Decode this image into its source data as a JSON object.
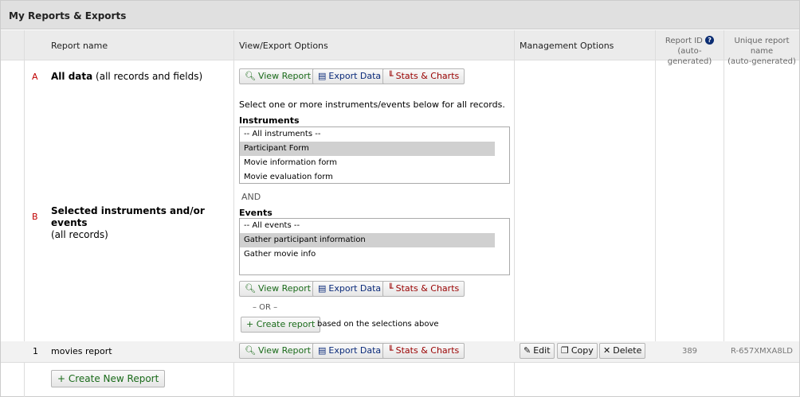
{
  "panel": {
    "title": "My Reports & Exports"
  },
  "columns": {
    "report_name": "Report name",
    "view_export": "View/Export Options",
    "management": "Management Options",
    "report_id": "Report ID",
    "report_id_sub": "(auto-generated)",
    "unique_name": "Unique report name",
    "unique_name_sub": "(auto-generated)",
    "help_glyph": "?"
  },
  "buttons": {
    "view_report": "View Report",
    "export_data": "Export Data",
    "stats_charts": "Stats & Charts",
    "create_report": "+ Create report",
    "create_new_report": "+ Create New Report",
    "edit": "Edit",
    "copy": "Copy",
    "delete": "Delete"
  },
  "icons": {
    "view": "search-icon",
    "export": "file-icon",
    "stats": "chart-icon",
    "edit": "pencil-icon",
    "copy": "copy-icon",
    "delete": "close-icon",
    "help": "help-icon"
  },
  "row_a": {
    "letter": "A",
    "name_bold": "All data",
    "name_rest": "(all records and fields)"
  },
  "row_b": {
    "letter": "B",
    "name_bold": "Selected instruments and/or events",
    "name_rest": "(all records)",
    "instructions": "Select one or more instruments/events below for all records.",
    "instruments_label": "Instruments",
    "instruments": [
      {
        "label": "-- All instruments --",
        "selected": false
      },
      {
        "label": "Participant Form",
        "selected": true
      },
      {
        "label": "Movie information form",
        "selected": false
      },
      {
        "label": "Movie evaluation form",
        "selected": false
      }
    ],
    "and_text": "AND",
    "events_label": "Events",
    "events": [
      {
        "label": "-- All events --",
        "selected": false
      },
      {
        "label": "Gather participant information",
        "selected": true
      },
      {
        "label": "Gather movie info",
        "selected": false
      }
    ],
    "or_text": "– OR –",
    "based_on": "based on the selections above"
  },
  "row_1": {
    "number": "1",
    "name": "movies report",
    "report_id": "389",
    "unique_name": "R-657XMXA8LD"
  }
}
